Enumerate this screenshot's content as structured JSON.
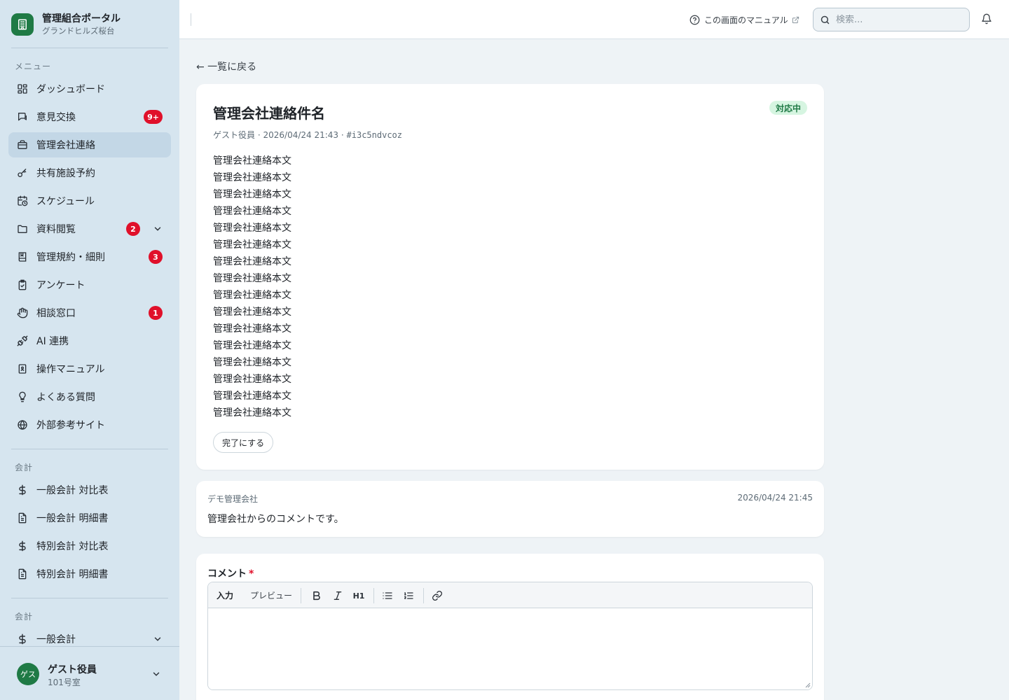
{
  "brand": {
    "title": "管理組合ポータル",
    "subtitle": "グランドヒルズ桜台"
  },
  "sidebar": {
    "menu_label": "メニュー",
    "items": [
      {
        "label": "ダッシュボード",
        "icon": "dashboard-icon"
      },
      {
        "label": "意見交換",
        "icon": "chat-icon",
        "badge": "9+"
      },
      {
        "label": "管理会社連絡",
        "icon": "briefcase-icon",
        "active": true
      },
      {
        "label": "共有施設予約",
        "icon": "key-icon"
      },
      {
        "label": "スケジュール",
        "icon": "calendar-clock-icon"
      },
      {
        "label": "資料閲覧",
        "icon": "folder-icon",
        "badge": "2",
        "expandable": true
      },
      {
        "label": "管理規約・細則",
        "icon": "book-icon",
        "badge": "3"
      },
      {
        "label": "アンケート",
        "icon": "clipboard-check-icon"
      },
      {
        "label": "相談窓口",
        "icon": "hand-icon",
        "badge": "1"
      },
      {
        "label": "AI 連携",
        "icon": "plug-icon"
      },
      {
        "label": "操作マニュアル",
        "icon": "manual-book-icon"
      },
      {
        "label": "よくある質問",
        "icon": "lightbulb-icon"
      },
      {
        "label": "外部参考サイト",
        "icon": "globe-icon"
      }
    ],
    "accounting_label": "会計",
    "accounting_items": [
      {
        "label": "一般会計 対比表",
        "icon": "dollar-icon"
      },
      {
        "label": "一般会計 明細書",
        "icon": "document-icon"
      },
      {
        "label": "特別会計 対比表",
        "icon": "dollar-icon"
      },
      {
        "label": "特別会計 明細書",
        "icon": "document-icon"
      }
    ],
    "accounting_label_2": "会計",
    "accounting_items_2": [
      {
        "label": "一般会計",
        "icon": "dollar-icon",
        "expandable": true
      }
    ]
  },
  "user": {
    "avatar": "ゲス",
    "name": "ゲスト役員",
    "room": "101号室"
  },
  "header": {
    "manual_link": "この画面のマニュアル",
    "search_placeholder": "検索..."
  },
  "page": {
    "back_link": "← 一覧に戻る"
  },
  "post": {
    "title": "管理会社連絡件名",
    "status": "対応中",
    "author": "ゲスト役員",
    "datetime": "2026/04/24 21:43",
    "id": "#i3c5ndvcoz",
    "body_lines": [
      "管理会社連絡本文",
      "管理会社連絡本文",
      "管理会社連絡本文",
      "管理会社連絡本文",
      "管理会社連絡本文",
      "管理会社連絡本文",
      "管理会社連絡本文",
      "管理会社連絡本文",
      "管理会社連絡本文",
      "管理会社連絡本文",
      "管理会社連絡本文",
      "管理会社連絡本文",
      "管理会社連絡本文",
      "管理会社連絡本文",
      "管理会社連絡本文",
      "管理会社連絡本文"
    ],
    "complete_button": "完了にする"
  },
  "comment": {
    "author": "デモ管理会社",
    "datetime": "2026/04/24 21:45",
    "text": "管理会社からのコメントです。"
  },
  "comment_form": {
    "label": "コメント",
    "required_mark": "*",
    "tab_input": "入力",
    "tab_preview": "プレビュー",
    "h1_label": "H1"
  },
  "colors": {
    "brand_green": "#1f7a45",
    "badge_red": "#e0102a",
    "sidebar_bg": "#d6e5ef",
    "status_bg": "#d6f5e1"
  }
}
